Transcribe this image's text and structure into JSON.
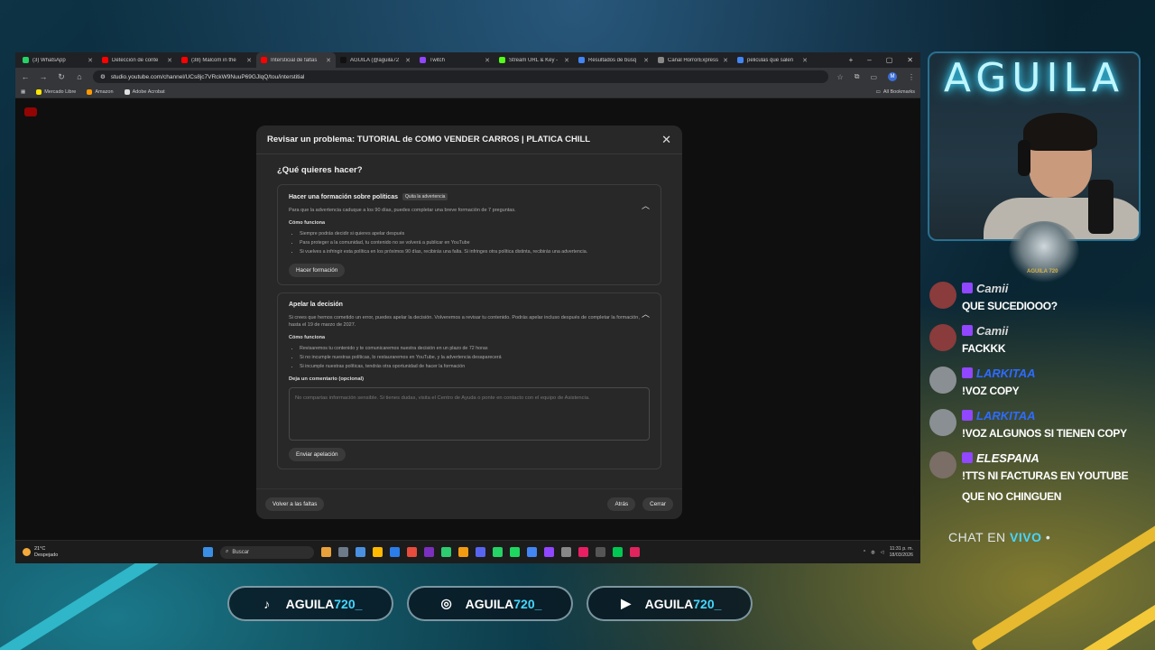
{
  "browser": {
    "tabs": [
      {
        "label": "(3) WhatsApp",
        "color": "#25d366",
        "active": false
      },
      {
        "label": "Detección de conte",
        "color": "#ff0000",
        "active": false
      },
      {
        "label": "(38) Malcom in the",
        "color": "#ff0000",
        "active": false
      },
      {
        "label": "Intersticial de faltas",
        "color": "#ff0000",
        "active": true
      },
      {
        "label": "AGUILA (@aguila72",
        "color": "#111111",
        "active": false
      },
      {
        "label": "Twitch",
        "color": "#9146ff",
        "active": false
      },
      {
        "label": "Stream URL & Key -",
        "color": "#53fc18",
        "active": false
      },
      {
        "label": "Resultados de búsq",
        "color": "#4285f4",
        "active": false
      },
      {
        "label": "Canal HorrorExpress",
        "color": "#888888",
        "active": false
      },
      {
        "label": "peliculas que salen",
        "color": "#4285f4",
        "active": false
      }
    ],
    "address": "studio.youtube.com/channel/UCs8jc7VRckW9NuuP69GJlqQ/tou/interstitial",
    "bookmarks": [
      "Mercado Libre",
      "Amazon",
      "Adobe Acrobat"
    ],
    "all_bookmarks": "All Bookmarks",
    "avatar_letter": "M"
  },
  "dialog": {
    "title": "Revisar un problema: TUTORIAL de COMO VENDER CARROS | PLATICA CHILL",
    "question": "¿Qué quieres hacer?",
    "training": {
      "title": "Hacer una formación sobre políticas",
      "badge": "Quita la advertencia",
      "desc": "Para que la advertencia caduque a los 90 días, puedes completar una breve formación de 7 preguntas.",
      "how_title": "Cómo funciona",
      "bullets": [
        "Siempre podrás decidir si quieres apelar después",
        "Para proteger a la comunidad, tu contenido no se volverá a publicar en YouTube",
        "Si vuelves a infringir esta política en los próximos 90 días, recibirás una falta. Si infringes otra política distinta, recibirás una advertencia."
      ],
      "button": "Hacer formación"
    },
    "appeal": {
      "title": "Apelar la decisión",
      "desc": "Si crees que hemos cometido un error, puedes apelar la decisión. Volveremos a revisar tu contenido. Podrás apelar incluso después de completar la formación, hasta el 19 de marzo de 2027.",
      "how_title": "Cómo funciona",
      "bullets": [
        "Revisaremos tu contenido y te comunicaremos nuestra decisión en un plazo de 72 horas",
        "Si no incumple nuestras políticas, lo restauraremos en YouTube, y la advertencia desaparecerá",
        "Si incumple nuestras políticas, tendrás otra oportunidad de hacer la formación"
      ],
      "comment_label": "Deja un comentario (opcional)",
      "comment_placeholder": "No compartas información sensible. Si tienes dudas, visita el Centro de Ayuda o ponte en contacto con el equipo de Asistencia.",
      "button": "Enviar apelación"
    },
    "footer": {
      "back_to_faults": "Volver a las faltas",
      "back": "Atrás",
      "close": "Cerrar"
    }
  },
  "taskbar": {
    "weather_temp": "21°C",
    "weather_desc": "Despejado",
    "search": "Buscar",
    "time": "11:31 p. m.",
    "date": "18/03/2026"
  },
  "stream": {
    "cam_title": "AGUILA",
    "eagle_label": "AGUILA 720",
    "chat": [
      {
        "user": "Camii",
        "text": "QUE SUCEDIOOO?",
        "name_color": "#d9d9d9",
        "pfp": "#8a3b3b"
      },
      {
        "user": "Camii",
        "text": "FACKKK",
        "name_color": "#d9d9d9",
        "pfp": "#8a3b3b"
      },
      {
        "user": "LARKITAA",
        "text": "!VOZ COPY",
        "name_color": "#2e6bff",
        "pfp": "#8a8f94"
      },
      {
        "user": "LARKITAA",
        "text": "!VOZ ALGUNOS SI TIENEN COPY",
        "name_color": "#2e6bff",
        "pfp": "#8a8f94"
      },
      {
        "user": "ELESPANA",
        "text": "!TTS NI FACTURAS EN YOUTUBE QUE NO CHINGUEN",
        "name_color": "#ffffff",
        "pfp": "#7a6e66"
      }
    ],
    "chat_live": "CHAT EN",
    "chat_live_hl": "VIVO",
    "socials": [
      {
        "name": "AGUILA",
        "hl": "720_",
        "icon": "tiktok-icon"
      },
      {
        "name": "AGUILA",
        "hl": "720_",
        "icon": "instagram-icon"
      },
      {
        "name": "AGUILA",
        "hl": "720_",
        "icon": "youtube-icon"
      }
    ]
  }
}
